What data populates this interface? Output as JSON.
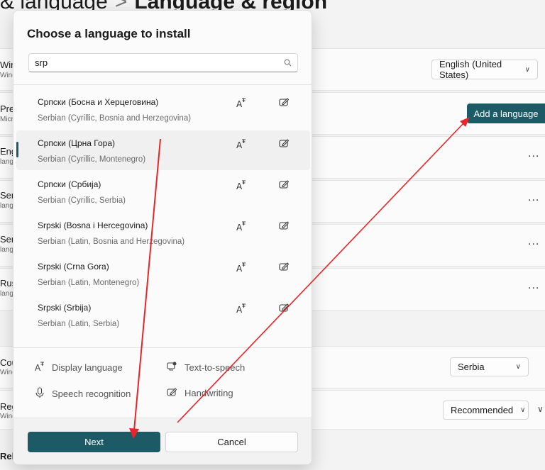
{
  "background": {
    "header": {
      "parent": "& language",
      "separator": ">",
      "current": "Language & region"
    },
    "rows": [
      {
        "title": "Windows display language",
        "subtitle": "Windows features like Settings and File Explorer"
      },
      {
        "title": "Preferred languages",
        "subtitle": "Microsoft Store apps will appear in the first supported language"
      },
      {
        "title": "English",
        "subtitle": "language pack"
      },
      {
        "title": "Serbian",
        "subtitle": "language"
      },
      {
        "title": "Serbian",
        "subtitle": "language"
      },
      {
        "title": "Russian",
        "subtitle": "language"
      },
      {
        "title": "Country or region",
        "subtitle": "Windows and apps might use"
      },
      {
        "title": "Regional format",
        "subtitle": "Windows and some apps"
      },
      {
        "title": "Related settings"
      }
    ],
    "display_language_value": "English (United States)",
    "add_language_label": "Add a language",
    "country_value": "Serbia",
    "regional_format_value": "Recommended",
    "more_label": "..."
  },
  "dialog": {
    "title": "Choose a language to install",
    "search_value": "srp",
    "languages": [
      {
        "name": "Српски (Босна и Херцеговина)",
        "description": "Serbian (Cyrillic, Bosnia and Herzegovina)"
      },
      {
        "name": "Српски (Црна Гора)",
        "description": "Serbian (Cyrillic, Montenegro)"
      },
      {
        "name": "Српски (Србија)",
        "description": "Serbian (Cyrillic, Serbia)"
      },
      {
        "name": "Srpski (Bosna i Hercegovina)",
        "description": "Serbian (Latin, Bosnia and Herzegovina)"
      },
      {
        "name": "Srpski (Crna Gora)",
        "description": "Serbian (Latin, Montenegro)"
      },
      {
        "name": "Srpski (Srbija)",
        "description": "Serbian (Latin, Serbia)"
      }
    ],
    "selected_index": 1,
    "feature_icons": [
      "display-language-icon",
      "handwriting-icon"
    ],
    "legend": {
      "display_language": "Display language",
      "text_to_speech": "Text-to-speech",
      "speech_recognition": "Speech recognition",
      "handwriting": "Handwriting"
    },
    "next_label": "Next",
    "cancel_label": "Cancel"
  },
  "colors": {
    "accent": "#1c5b66",
    "annotation_arrow": "#e8262a"
  }
}
